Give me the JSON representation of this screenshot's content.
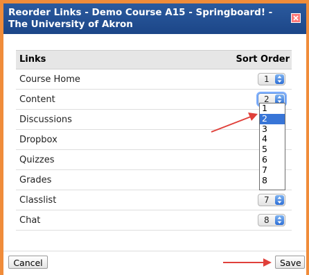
{
  "dialog": {
    "title": "Reorder Links - Demo Course A15 - Springboard! - The University of Akron"
  },
  "table": {
    "headers": {
      "links": "Links",
      "sort_order": "Sort Order"
    },
    "rows": [
      {
        "name": "Course Home",
        "order": "1"
      },
      {
        "name": "Content",
        "order": "2"
      },
      {
        "name": "Discussions",
        "order": ""
      },
      {
        "name": "Dropbox",
        "order": ""
      },
      {
        "name": "Quizzes",
        "order": ""
      },
      {
        "name": "Grades",
        "order": ""
      },
      {
        "name": "Classlist",
        "order": "7"
      },
      {
        "name": "Chat",
        "order": "8"
      }
    ]
  },
  "dropdown": {
    "options": [
      "1",
      "2",
      "3",
      "4",
      "5",
      "6",
      "7",
      "8"
    ],
    "selected": "2"
  },
  "buttons": {
    "cancel": "Cancel",
    "save": "Save"
  },
  "colors": {
    "frame": "#f08c3a",
    "titlebar": "#1c4688",
    "selected_option": "#3875d7",
    "annotation_arrow": "#e0403a"
  },
  "icons": {
    "close": "close-icon",
    "select_arrows": "chevron-updown-icon",
    "annotation": "red-arrow"
  }
}
